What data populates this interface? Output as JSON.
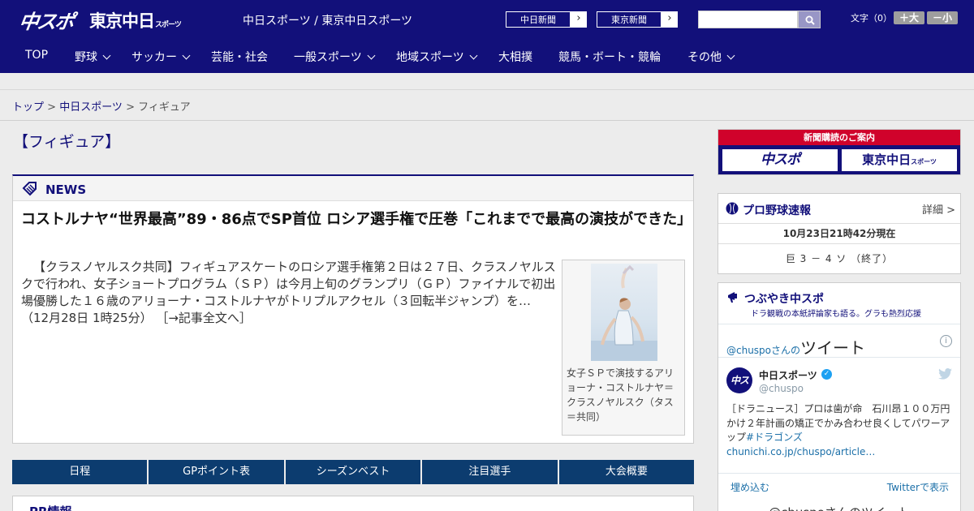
{
  "header": {
    "logo_chuspo": "中スポ",
    "logo_tokyo": "東京中日",
    "logo_tokyo_small": "スポーツ",
    "site_links": "中日スポーツ / 東京中日スポーツ",
    "btn_chunichi": "中日新聞",
    "btn_tokyo": "東京新聞",
    "arrow": "›",
    "search_placeholder": "",
    "font_size_label": "文字（0）",
    "font_bigger": "＋大",
    "font_smaller": "－小"
  },
  "nav": {
    "items": [
      {
        "label": "TOP"
      },
      {
        "label": "野球"
      },
      {
        "label": "サッカー"
      },
      {
        "label": "芸能・社会"
      },
      {
        "label": "一般スポーツ"
      },
      {
        "label": "地域スポーツ"
      },
      {
        "label": "大相撲"
      },
      {
        "label": "競馬・ボート・競輪"
      },
      {
        "label": "その他"
      }
    ]
  },
  "breadcrumb": {
    "top": "トップ",
    "sep": " > ",
    "chunichi": "中日スポーツ",
    "current": "フィギュア"
  },
  "main": {
    "page_title": "【フィギュア】",
    "news_label": "NEWS",
    "headline": "コストルナヤ“世界最高”89・86点でSP首位 ロシア選手権で圧巻「これまでで最高の演技ができた」",
    "body": "【クラスノヤルスク共同】フィギュアスケートのロシア選手権第２日は２７日、クラスノヤルスクで行われ、女子ショートプログラム（ＳＰ）は今月上旬のグランプリ（ＧＰ）ファイナルで初出場優勝した１６歳のアリョーナ・コストルナヤがトリプルアクセル（３回転半ジャンプ）を…（12月28日 1時25分）",
    "read_more": "［→記事全文へ］",
    "photo_caption": "女子ＳＰで演技するアリョーナ・コストルナヤ＝クラスノヤルスク（タス＝共同）",
    "tabs": [
      "日程",
      "GPポイント表",
      "シーズンベスト",
      "注目選手",
      "大会概要"
    ],
    "pr_title": "PR情報"
  },
  "sidebar": {
    "subscribe_label": "新聞購読のご案内",
    "sub_logo_1": "中スポ",
    "sub_logo_2": "東京中日",
    "sub_logo_2_small": "スポーツ",
    "baseball_title": "プロ野球速報",
    "baseball_more": "詳細 >",
    "baseball_time": "10月23日21時42分現在",
    "baseball_score": "巨 3 － 4 ソ （終了）",
    "tweet_title": "つぶやき中スポ",
    "tweet_subtitle": "ドラ観戦の本紙評論家も語る。グラも熱烈応援",
    "tw_head_handle": "@chuspo",
    "tw_head_suffix": "さんの",
    "tw_head_big": "ツイート",
    "tw_info": "i",
    "tw_name": "中日スポーツ",
    "tw_verified": "✓",
    "tw_handle": "@chuspo",
    "tw_avatar": "中スポ",
    "tw_text": "［ドラニュース］プロは歯が命　石川昂１００万円かけ２年計画の矯正でかみ合わせ良くしてパワーアップ",
    "tw_text_link": "#ドラゴンズ chunichi.co.jp/chuspo/article…",
    "tw_embed": "埋め込む",
    "tw_view": "Twitterで表示",
    "tw_more": "@chuspoさんのツイート"
  },
  "colors": {
    "brand_navy": "#12107a",
    "tab_blue": "#0c3c6f",
    "subscribe_red": "#d0022b"
  }
}
